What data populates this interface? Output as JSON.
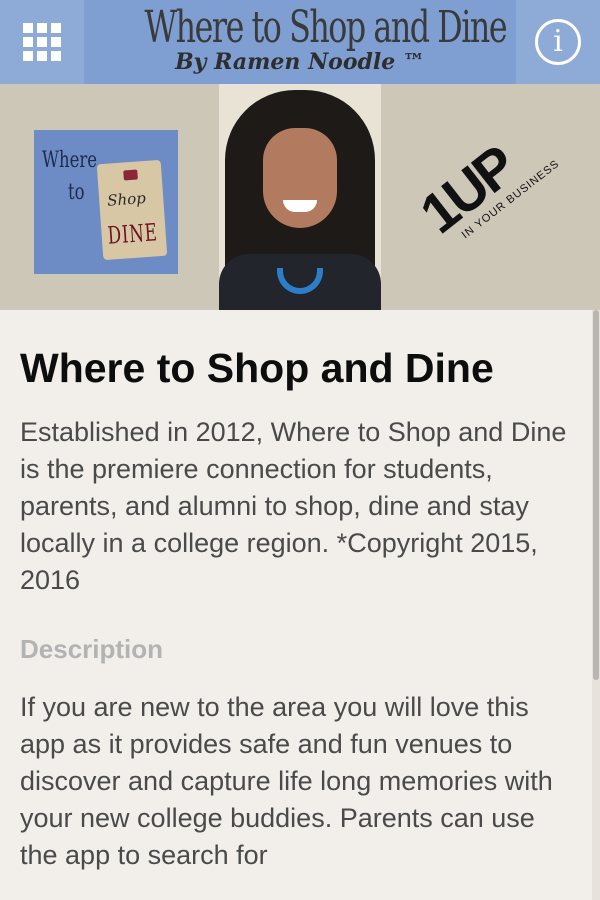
{
  "header": {
    "title": "Where to Shop and Dine",
    "subtitle": "By Ramen Noodle ™",
    "menu_icon": "grid-icon",
    "info_icon": "info-icon",
    "info_glyph": "i",
    "bg_color": "#8eaad6"
  },
  "banner": {
    "logo_where": "Where",
    "logo_to": "to",
    "logo_shop": "Shop",
    "logo_dine": "DINE",
    "up_big": "1UP",
    "up_small": "IN YOUR BUSINESS"
  },
  "main": {
    "title": "Where to Shop and Dine",
    "intro": "Established in 2012, Where to Shop and Dine is the premiere connection for students, parents, and alumni to shop, dine and stay locally in a college region. *Copyright 2015, 2016",
    "description_heading": "Description",
    "description_body": "If you are new to the area you will love this app as it provides safe and fun venues to discover and capture life long memories with your new college buddies. Parents can use the app to search for"
  }
}
